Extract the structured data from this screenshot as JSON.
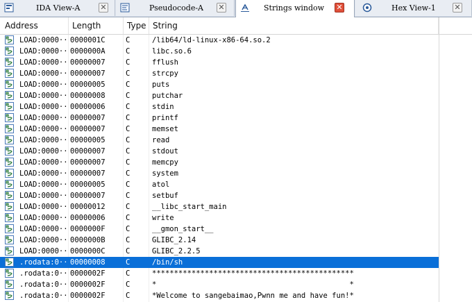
{
  "tabs": [
    {
      "label": "IDA View-A",
      "icon": "ida-view-icon",
      "active": false
    },
    {
      "label": "Pseudocode-A",
      "icon": "pseudocode-icon",
      "active": false
    },
    {
      "label": "Strings window",
      "icon": "strings-icon",
      "active": true
    },
    {
      "label": "Hex View-1",
      "icon": "hex-view-icon",
      "active": false
    }
  ],
  "table": {
    "columns": [
      "Address",
      "Length",
      "Type",
      "String"
    ],
    "selected_row": 20,
    "rows": [
      {
        "address": "LOAD:0000···",
        "length": "0000001C",
        "type": "C",
        "string": "/lib64/ld-linux-x86-64.so.2"
      },
      {
        "address": "LOAD:0000···",
        "length": "0000000A",
        "type": "C",
        "string": "libc.so.6"
      },
      {
        "address": "LOAD:0000···",
        "length": "00000007",
        "type": "C",
        "string": "fflush"
      },
      {
        "address": "LOAD:0000···",
        "length": "00000007",
        "type": "C",
        "string": "strcpy"
      },
      {
        "address": "LOAD:0000···",
        "length": "00000005",
        "type": "C",
        "string": "puts"
      },
      {
        "address": "LOAD:0000···",
        "length": "00000008",
        "type": "C",
        "string": "putchar"
      },
      {
        "address": "LOAD:0000···",
        "length": "00000006",
        "type": "C",
        "string": "stdin"
      },
      {
        "address": "LOAD:0000···",
        "length": "00000007",
        "type": "C",
        "string": "printf"
      },
      {
        "address": "LOAD:0000···",
        "length": "00000007",
        "type": "C",
        "string": "memset"
      },
      {
        "address": "LOAD:0000···",
        "length": "00000005",
        "type": "C",
        "string": "read"
      },
      {
        "address": "LOAD:0000···",
        "length": "00000007",
        "type": "C",
        "string": "stdout"
      },
      {
        "address": "LOAD:0000···",
        "length": "00000007",
        "type": "C",
        "string": "memcpy"
      },
      {
        "address": "LOAD:0000···",
        "length": "00000007",
        "type": "C",
        "string": "system"
      },
      {
        "address": "LOAD:0000···",
        "length": "00000005",
        "type": "C",
        "string": "atol"
      },
      {
        "address": "LOAD:0000···",
        "length": "00000007",
        "type": "C",
        "string": "setbuf"
      },
      {
        "address": "LOAD:0000···",
        "length": "00000012",
        "type": "C",
        "string": "__libc_start_main"
      },
      {
        "address": "LOAD:0000···",
        "length": "00000006",
        "type": "C",
        "string": "write"
      },
      {
        "address": "LOAD:0000···",
        "length": "0000000F",
        "type": "C",
        "string": "__gmon_start__"
      },
      {
        "address": "LOAD:0000···",
        "length": "0000000B",
        "type": "C",
        "string": "GLIBC_2.14"
      },
      {
        "address": "LOAD:0000···",
        "length": "0000000C",
        "type": "C",
        "string": "GLIBC_2.2.5"
      },
      {
        "address": ".rodata:0···",
        "length": "00000008",
        "type": "C",
        "string": "/bin/sh"
      },
      {
        "address": ".rodata:0···",
        "length": "0000002F",
        "type": "C",
        "string": "**********************************************"
      },
      {
        "address": ".rodata:0···",
        "length": "0000002F",
        "type": "C",
        "string": "*                                            *"
      },
      {
        "address": ".rodata:0···",
        "length": "0000002F",
        "type": "C",
        "string": "*Welcome to sangebaimao,Pwnn me and have fun!*"
      }
    ]
  },
  "colors": {
    "selection": "#0a6fd8",
    "active_close": "#e0503a",
    "row_icon": "#2a7a3a"
  }
}
